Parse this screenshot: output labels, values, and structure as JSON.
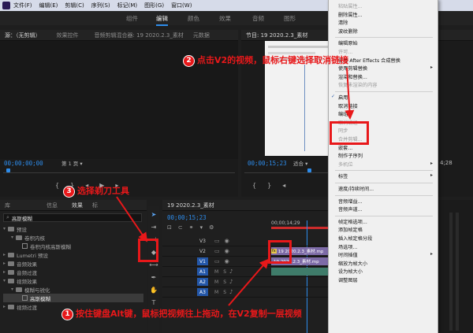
{
  "menubar": {
    "items": [
      "文件(F)",
      "编辑(E)",
      "剪辑(C)",
      "序列(S)",
      "标记(M)",
      "图形(G)",
      "窗口(W)"
    ]
  },
  "workspaces": {
    "items": [
      "组件",
      "编辑",
      "颜色",
      "效果",
      "音频",
      "图形"
    ],
    "active": "编辑"
  },
  "source_panel": {
    "tabs": [
      "源：（无剪辑）",
      "效果控件",
      "音频剪辑混合器: 19 2020.2.3_素材",
      "元数据"
    ],
    "timecode": "00;00;00;00",
    "page_label": "第 1 页"
  },
  "program_panel": {
    "title": "节目: 19 2020.2.3_素材",
    "timecode": "00;00;15;23",
    "fit_label": "适合",
    "duration_fragment": "4;28"
  },
  "project_panel": {
    "tabs": [
      "库",
      "信息",
      "效果",
      "标"
    ],
    "search_value": "高斯模糊",
    "tree": [
      {
        "label": "预设",
        "level": 0,
        "type": "folder"
      },
      {
        "label": "卷积内核",
        "level": 1,
        "type": "folder"
      },
      {
        "label": "卷积内核高斯模糊",
        "level": 2,
        "type": "fx"
      },
      {
        "label": "Lumetri 预设",
        "level": 0,
        "type": "folder"
      },
      {
        "label": "音频效果",
        "level": 0,
        "type": "folder"
      },
      {
        "label": "音频过渡",
        "level": 0,
        "type": "folder"
      },
      {
        "label": "视频效果",
        "level": 0,
        "type": "folder"
      },
      {
        "label": "模糊与锐化",
        "level": 1,
        "type": "folder"
      },
      {
        "label": "高斯模糊",
        "level": 2,
        "type": "fx",
        "selected": true
      },
      {
        "label": "视频过渡",
        "level": 0,
        "type": "folder"
      }
    ]
  },
  "tools": {
    "items": [
      "selection-tool",
      "track-select-tool",
      "ripple-edit-tool",
      "razor-tool",
      "slip-tool",
      "pen-tool",
      "hand-tool",
      "type-tool"
    ]
  },
  "timeline": {
    "title": "19 2020.2.3_素材",
    "timecode": "00;00;15;23",
    "ruler_label": "00;00;14;29",
    "tracks": [
      {
        "name": "V3",
        "kind": "video"
      },
      {
        "name": "V2",
        "kind": "video"
      },
      {
        "name": "V1",
        "kind": "video"
      },
      {
        "name": "A1",
        "kind": "audio"
      },
      {
        "name": "A2",
        "kind": "audio"
      },
      {
        "name": "A3",
        "kind": "audio"
      }
    ],
    "clip_label_v2": "19 2020.2.3_素材.mp",
    "clip_label_v1": "19 2020.2.3_素材.mp",
    "track_letters": {
      "m": "M",
      "s": "S"
    }
  },
  "context_menu": {
    "items": [
      {
        "label": "粘贴属性...",
        "disabled": true
      },
      {
        "label": "删除属性...",
        "disabled": false
      },
      {
        "label": "清除",
        "disabled": false
      },
      {
        "label": "波纹删除",
        "disabled": false
      },
      {
        "sep": true
      },
      {
        "label": "编辑原始",
        "disabled": false
      },
      {
        "label": "许可...",
        "disabled": true
      },
      {
        "label": "使用 After Effects 合成替换",
        "disabled": false
      },
      {
        "label": "使用剪辑替换",
        "disabled": false,
        "arrow": true
      },
      {
        "label": "渲染和替换...",
        "disabled": false
      },
      {
        "label": "恢复未渲染的内容",
        "disabled": true
      },
      {
        "sep": true
      },
      {
        "label": "启用",
        "disabled": false,
        "check": true
      },
      {
        "label": "取消链接",
        "disabled": false
      },
      {
        "label": "编组",
        "disabled": false
      },
      {
        "label": "取消编组",
        "disabled": true
      },
      {
        "label": "同步",
        "disabled": true
      },
      {
        "label": "合并剪辑...",
        "disabled": true
      },
      {
        "label": "嵌套...",
        "disabled": false
      },
      {
        "label": "制作子序列",
        "disabled": false
      },
      {
        "label": "多机位",
        "disabled": true,
        "arrow": true
      },
      {
        "sep": true
      },
      {
        "label": "标签",
        "disabled": false,
        "arrow": true
      },
      {
        "sep": true
      },
      {
        "label": "速度/持续时间...",
        "disabled": false
      },
      {
        "sep": true
      },
      {
        "label": "音频增益...",
        "disabled": false
      },
      {
        "label": "音频声道...",
        "disabled": false
      },
      {
        "sep": true
      },
      {
        "label": "帧定格选项...",
        "disabled": false
      },
      {
        "label": "添加帧定格",
        "disabled": false
      },
      {
        "label": "插入帧定格分段",
        "disabled": false
      },
      {
        "label": "场选项...",
        "disabled": false
      },
      {
        "label": "时间插值",
        "disabled": false,
        "arrow": true
      },
      {
        "label": "缩放为帧大小",
        "disabled": false
      },
      {
        "label": "设为帧大小",
        "disabled": false
      },
      {
        "label": "调整图层",
        "disabled": false
      }
    ]
  },
  "annotations": {
    "step1": {
      "num": "1",
      "text": "按住键盘Alt键，鼠标把视频往上拖动，在V2复制一层视频"
    },
    "step2": {
      "num": "2",
      "text": "点击V2的视频，鼠标右键选择取消链接"
    },
    "step3": {
      "num": "3",
      "text": "选择剃刀工具"
    }
  },
  "colors": {
    "accent": "#2d8ceb",
    "annotation": "#e8181a",
    "video_clip": "#7d6ba7",
    "audio_clip": "#3f7c6a"
  }
}
